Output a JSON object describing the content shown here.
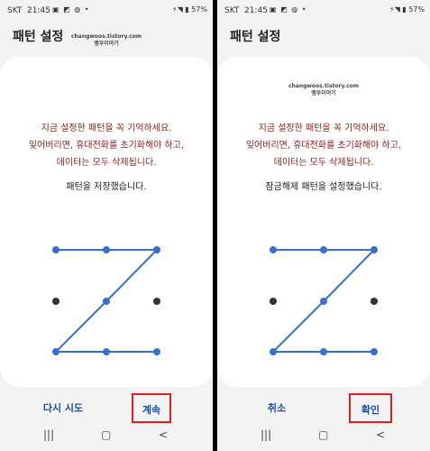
{
  "status": {
    "carrier": "SKT",
    "time": "21:45",
    "battery": "57%"
  },
  "left": {
    "title": "패턴 설정",
    "watermark_line1": "changwoos.tistory.com",
    "watermark_line2": "앵우이야기",
    "warning": [
      "지금 설정한 패턴을 꼭 기억하세요.",
      "잊어버리면, 휴대전화를 초기화해야 하고,",
      "데이터는 모두 삭제됩니다."
    ],
    "message": "패턴을 저장했습니다.",
    "buttons": {
      "left": "다시 시도",
      "right": "계속"
    }
  },
  "right": {
    "title": "패턴 설정",
    "watermark_line1": "changwoos.tistory.com",
    "watermark_line2": "앵우이야기",
    "warning": [
      "지금 설정한 패턴을 꼭 기억하세요.",
      "잊어버리면, 휴대전화를 초기화해야 하고,",
      "데이터는 모두 삭제됩니다."
    ],
    "message": "잠금해제 패턴을 설정했습니다.",
    "buttons": {
      "left": "취소",
      "right": "확인"
    }
  },
  "colors": {
    "accent": "#3a6fc9",
    "warning": "#8b1d1d",
    "highlight": "#e21d1d"
  },
  "icons": {
    "recent": "recents-icon",
    "home": "home-icon",
    "back": "back-icon"
  }
}
